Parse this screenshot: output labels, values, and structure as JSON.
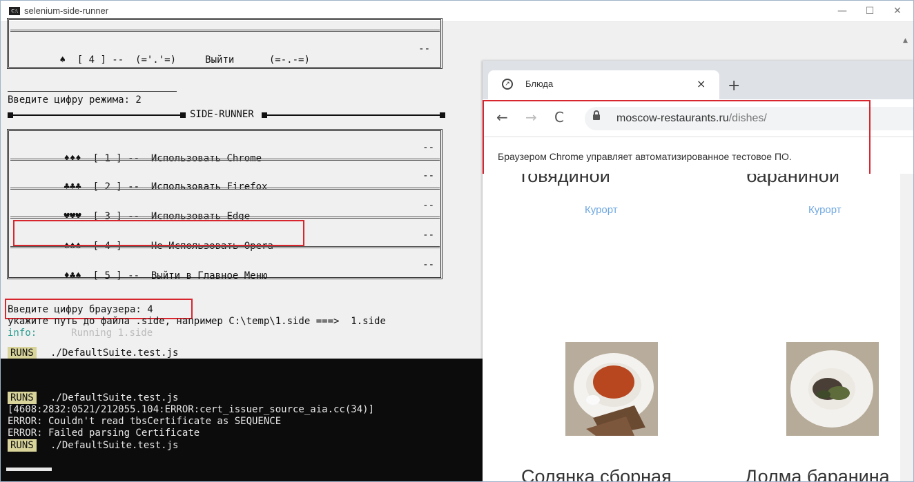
{
  "console": {
    "title": "selenium-side-runner",
    "title_icon": "C:\\",
    "controls": {
      "minimize": "—",
      "maximize": "☐",
      "close": "✕"
    },
    "top_row": {
      "text": "♠  [ 4 ] --  (='.'=)     Выйти      (=-.-=)",
      "end": "--"
    },
    "prompt_mode": "Введите цифру режима: 2",
    "side_runner_header": "SIDE-RUNNER",
    "menu_items": [
      {
        "text": "♦♦♦  [ 1 ] --  Использовать Chrome",
        "end": "--"
      },
      {
        "text": "♣♣♣  [ 2 ] --  Использовать Firefox",
        "end": "--"
      },
      {
        "text": "♥♥♥  [ 3 ] --  Использовать Edge",
        "end": "--"
      },
      {
        "text": "♠♠♠  [ 4 ] --  Не Использовать Opera",
        "end": "--"
      },
      {
        "text": "♦♣♠  [ 5 ] --  Выйти в Главное Меню",
        "end": "--"
      }
    ],
    "prompt_browser": "Введите цифру браузера: 4",
    "path_prompt": "укажите путь до файла .side, например C:\\temp\\1.side ===>  1.side",
    "info_label": "info:",
    "info_text": "Running 1.side",
    "runs_label": "RUNS",
    "runs_file": "./DefaultSuite.test.js",
    "error_line1": "[4608:2832:0521/212055.104:ERROR:cert_issuer_source_aia.cc(34)]",
    "error_line2": "ERROR: Couldn't read tbsCertificate as SEQUENCE",
    "error_line3": "ERROR: Failed parsing Certificate"
  },
  "chrome": {
    "tab_title": "Блюда",
    "tab_close": "×",
    "new_tab": "+",
    "back": "←",
    "forward": "→",
    "reload": "C",
    "url_domain": "moscow-restaurants.ru",
    "url_path": "/dishes/",
    "info_bar": "Браузером Chrome управляет автоматизированное тестовое ПО.",
    "dishes": [
      {
        "name_partial": "говядиной",
        "tag": "Курорт",
        "next_name": "Солянка сборная"
      },
      {
        "name_partial": "бараниной",
        "tag": "Курорт",
        "next_name": "Долма баранина"
      }
    ]
  },
  "colors": {
    "highlight_red": "#d8262f",
    "console_bg": "#f0f0f0",
    "terminal_bg": "#0c0c0c",
    "runs_bg": "#d9d49a",
    "link_blue": "#6ea7e0"
  }
}
